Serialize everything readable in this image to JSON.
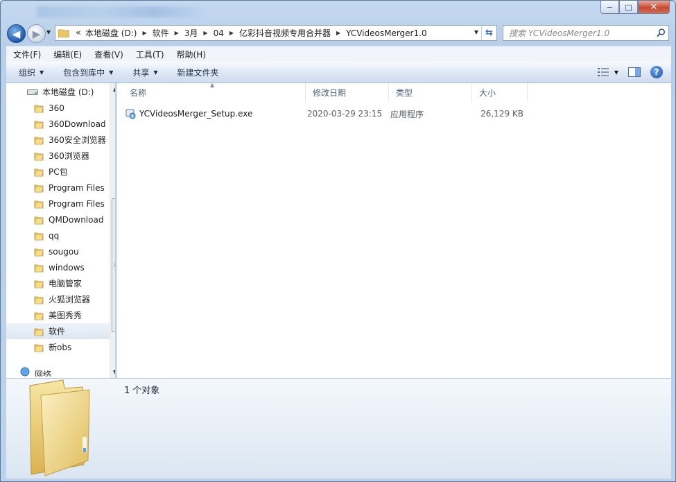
{
  "window": {
    "caption_minimize": "−",
    "caption_maximize": "□",
    "caption_close": "✕"
  },
  "address": {
    "overflow": "«",
    "crumbs": [
      "本地磁盘 (D:)",
      "软件",
      "3月",
      "04",
      "亿彩抖音视频专用合并器",
      "YCVideosMerger1.0"
    ],
    "search_placeholder": "搜索 YCVideosMerger1.0"
  },
  "menu": [
    "文件(F)",
    "编辑(E)",
    "查看(V)",
    "工具(T)",
    "帮助(H)"
  ],
  "commands": {
    "organize": "组织",
    "include_library": "包含到库中",
    "share": "共享",
    "new_folder": "新建文件夹",
    "help": "?"
  },
  "nav": {
    "drive": "本地磁盘 (D:)",
    "folders": [
      "360",
      "360Download",
      "360安全浏览器",
      "360浏览器",
      "PC包",
      "Program Files",
      "Program Files",
      "QMDownload",
      "qq",
      "sougou",
      "windows",
      "电脑管家",
      "火狐浏览器",
      "美图秀秀",
      "软件",
      "新obs"
    ],
    "selected_index": 14,
    "partial_item": "网络"
  },
  "columns": {
    "name": "名称",
    "modified": "修改日期",
    "type": "类型",
    "size": "大小"
  },
  "files": [
    {
      "name": "YCVideosMerger_Setup.exe",
      "modified": "2020-03-29 23:15",
      "type": "应用程序",
      "size": "26,129 KB"
    }
  ],
  "details": {
    "count": "1",
    "label": "个对象"
  },
  "colors": {
    "accent_blue": "#2a5ea8",
    "folder_yellow": "#e8c766",
    "selection": "#dde7f2"
  }
}
